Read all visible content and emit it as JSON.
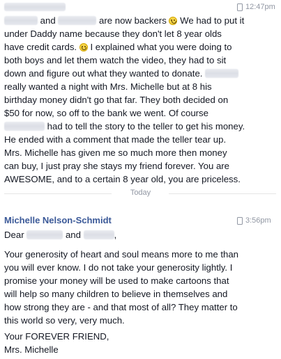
{
  "message1": {
    "time": "12:47pm",
    "lines": [
      "and",
      "are now backers",
      "We had to put it",
      "under Daddy name because they don't let 8 year olds",
      "have credit cards.",
      "I explained what you were doing to",
      "both boys and let them watch the video, they had to sit",
      "down and figure out what they wanted to donate.",
      "really wanted a night with Mrs. Michelle but at 8 his",
      "birthday money didn't go that far. They both decided on",
      "$50 for now, so off to the bank we went. Of course",
      "had to tell the story to the teller to get his money.",
      "He ended with a comment that made the teller tear up.",
      "Mrs. Michelle has given me so much more then money",
      "can buy, I just pray she stays my friend forever. You are",
      "AWESOME, and to a certain 8 year old, you are priceless."
    ]
  },
  "divider": {
    "label": "Today"
  },
  "message2": {
    "sender": "Michelle Nelson-Schmidt",
    "time": "3:56pm",
    "greeting": {
      "dear": "Dear",
      "and": "and",
      "comma": ","
    },
    "body_lines": [
      "Your generosity of heart and soul means more to me than",
      "you will ever know. I do not take your generosity lightly. I",
      "promise your money will be used to make cartoons that",
      "will help so many children to believe in themselves and",
      "how strong they are - and that most of all? They matter to",
      "this world so very, very much."
    ],
    "signoff": [
      "Your FOREVER FRIEND,",
      "Mrs. Michelle"
    ]
  }
}
